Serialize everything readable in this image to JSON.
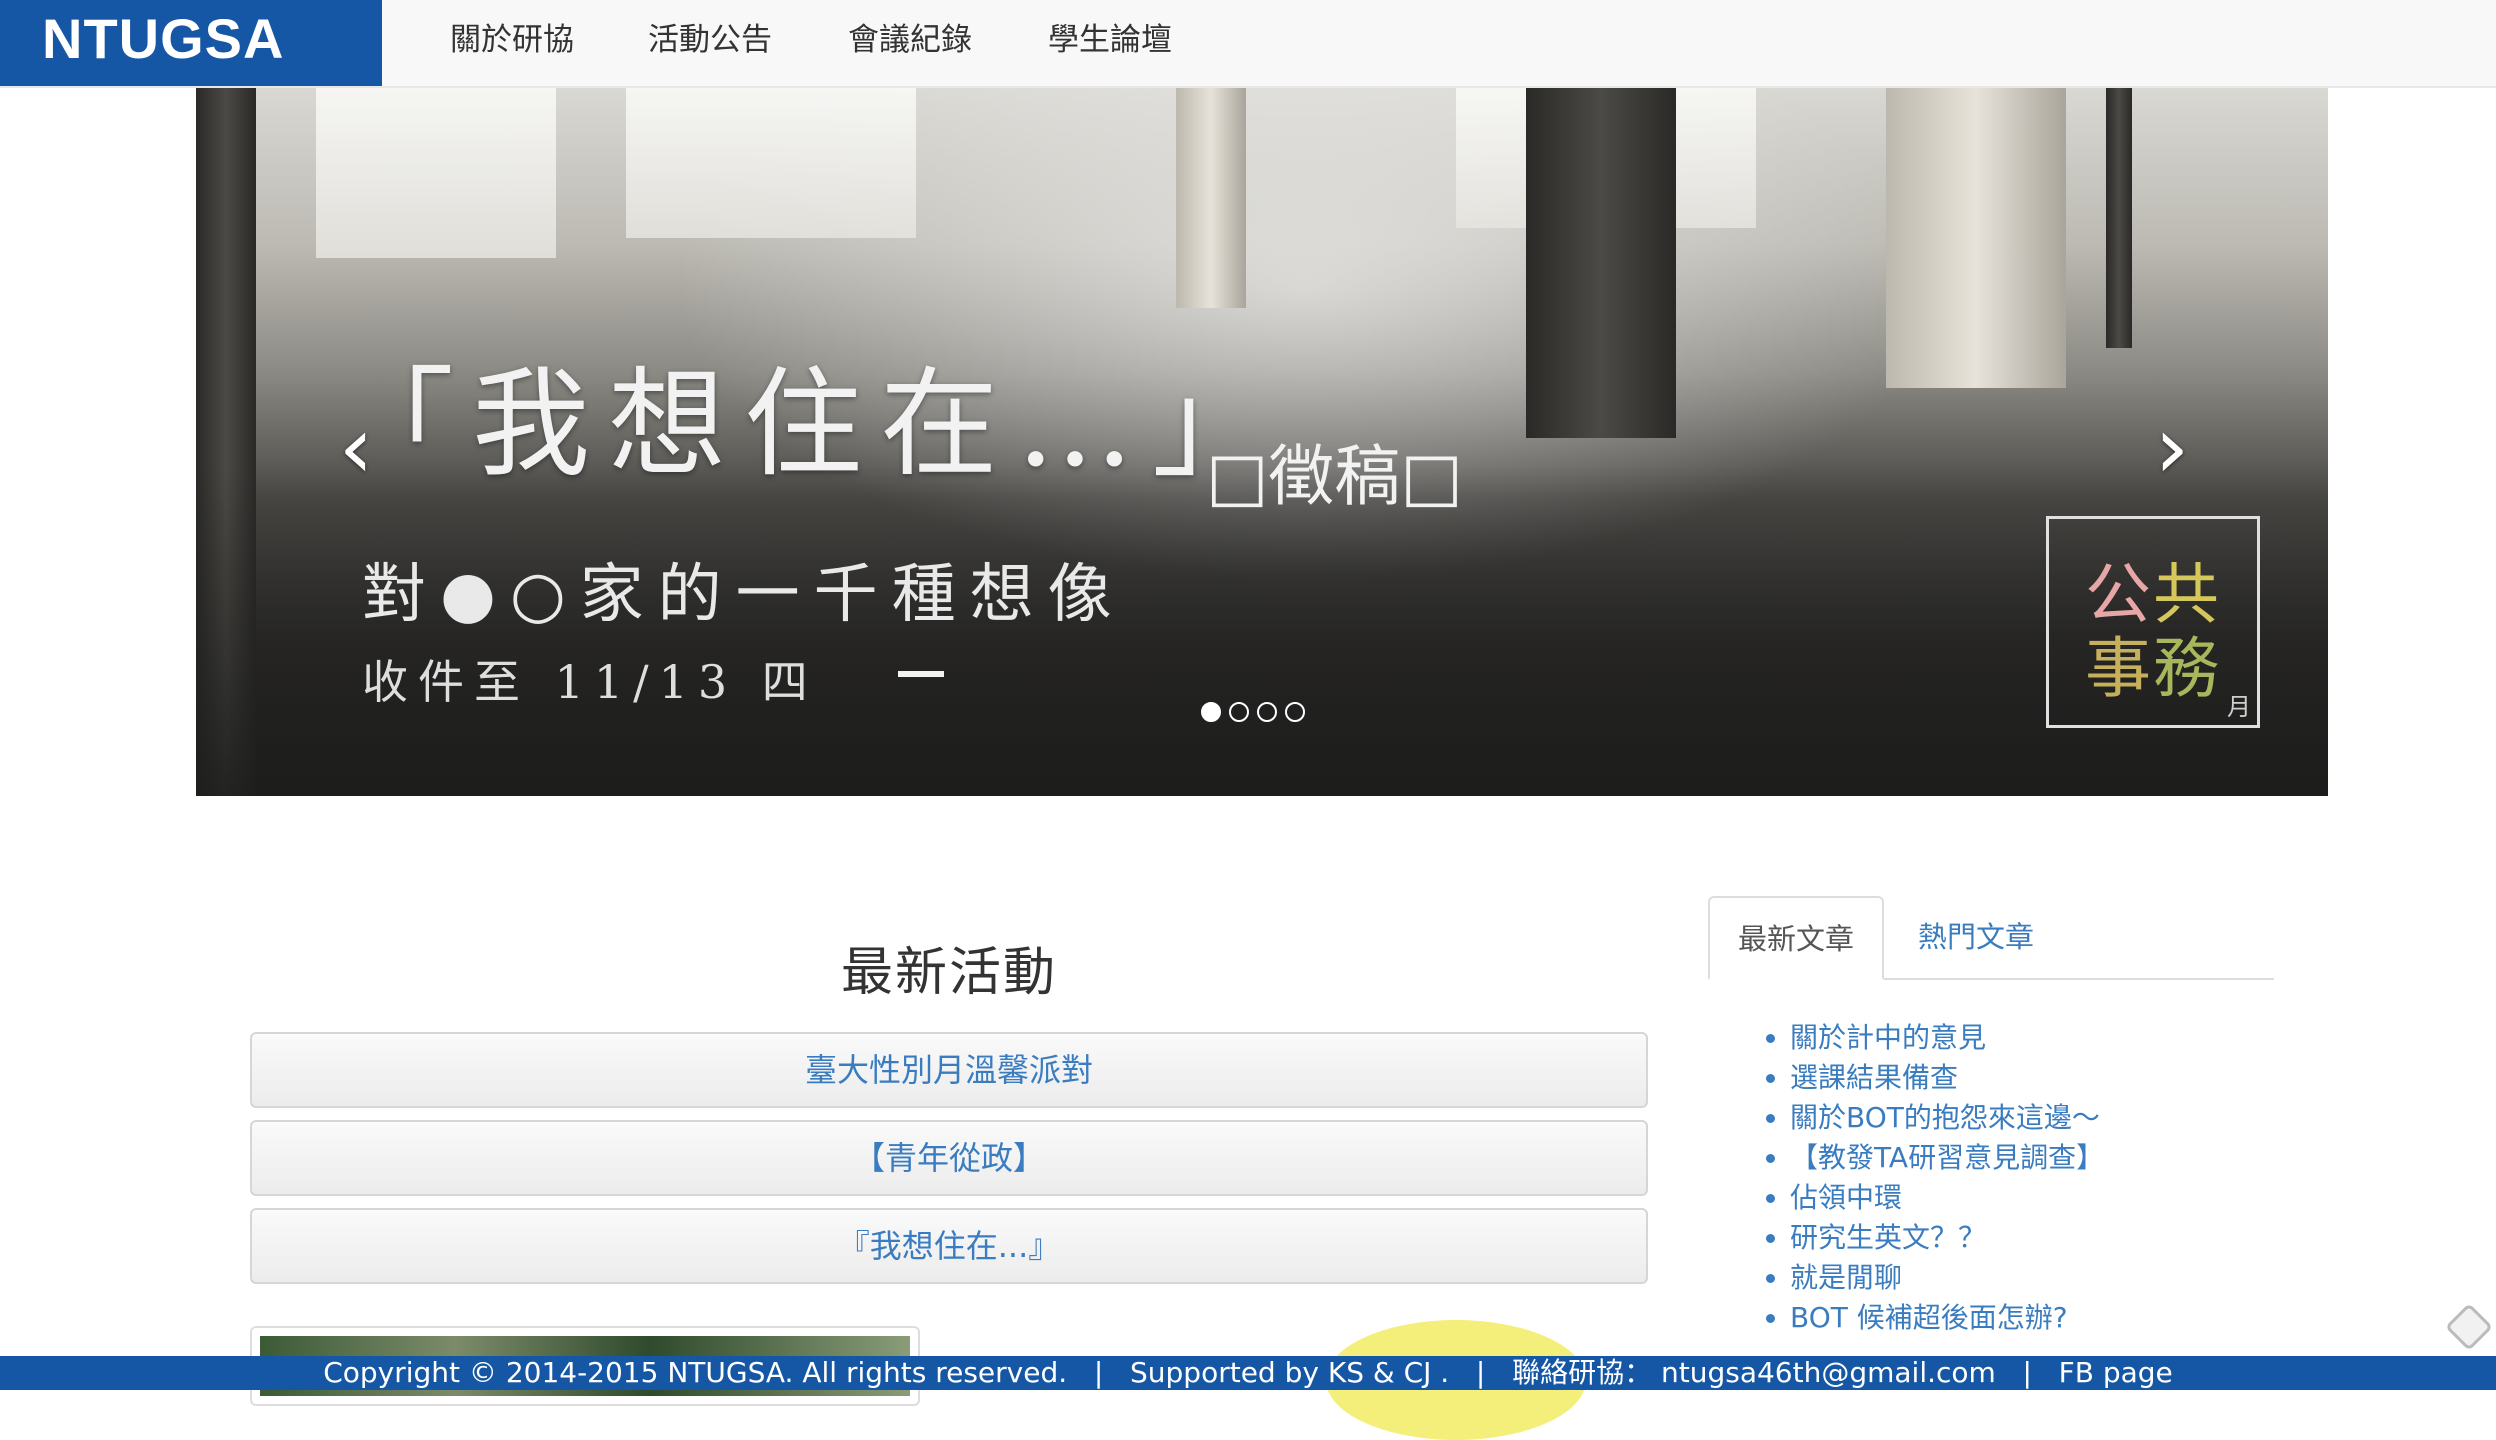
{
  "navbar": {
    "brand": "NTUGSA",
    "items": [
      {
        "label": "關於研協"
      },
      {
        "label": "活動公告"
      },
      {
        "label": "會議紀錄"
      },
      {
        "label": "學生論壇"
      }
    ]
  },
  "carousel": {
    "title": "「我想住在…」",
    "title_suffix": "□徵稿□",
    "subtitle": "對●○家的一千種想像",
    "deadline": "收件至 11/13 四",
    "prev_arrow": "‹",
    "next_arrow": "›",
    "badge": {
      "c1": "公",
      "c2": "共",
      "c3": "事",
      "c4": "務",
      "c5": "月"
    },
    "indicators": 4,
    "active_indicator": 0
  },
  "main": {
    "section_title": "最新活動",
    "events": [
      {
        "label": "臺大性別月溫馨派對"
      },
      {
        "label": "【青年從政】"
      },
      {
        "label": "『我想住在...』"
      }
    ]
  },
  "sidebar": {
    "tabs": [
      {
        "label": "最新文章",
        "active": true
      },
      {
        "label": "熱門文章",
        "active": false
      }
    ],
    "posts": [
      "關於計中的意見",
      "選課結果備查",
      "關於BOT的抱怨來這邊～",
      "【教發TA研習意見調查】",
      "佔領中環",
      "研究生英文？？",
      "就是閒聊",
      "BOT 候補超後面怎辦?"
    ]
  },
  "footer": {
    "copyright": "Copyright © 2014-2015 NTUGSA. All rights reserved.",
    "sep": "|",
    "supported": "Supported by KS & CJ .",
    "contact_label": "聯絡研協：",
    "contact_email": "ntugsa46th@gmail.com",
    "fb": "FB page"
  },
  "colors": {
    "brand_blue": "#1557a5",
    "link_blue": "#3a7cc0"
  }
}
